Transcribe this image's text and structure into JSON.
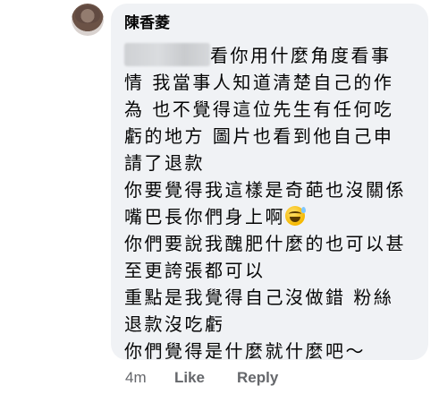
{
  "comment": {
    "author": "陳香菱",
    "redacted_prefix": "",
    "lines": [
      "看你用什麼角度看事",
      "情 我當事人知道清楚自己的作",
      "為 也不覺得這位先生有任何吃",
      "虧的地方 圖片也看到他自己申",
      "請了退款",
      "你要覺得我這樣是奇葩也沒關係",
      "嘴巴長你們身上啊",
      "你們要說我醜肥什麼的也可以甚",
      "至更誇張都可以",
      "重點是我覺得自己沒做錯 粉絲",
      "退款沒吃虧",
      "你們覺得是什麼就什麼吧〜"
    ],
    "emoji": "grinning-sweat-face"
  },
  "actions": {
    "time": "4m",
    "like": "Like",
    "reply": "Reply"
  }
}
